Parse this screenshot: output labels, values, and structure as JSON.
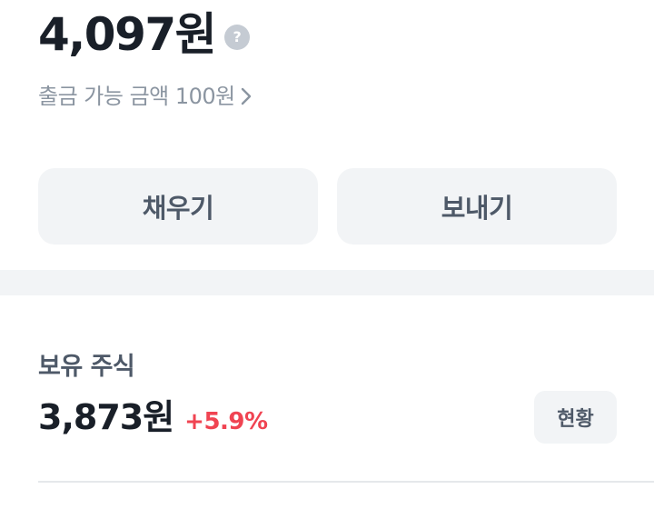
{
  "balance": {
    "amount": "4,097원",
    "help_icon": "question-circle-icon",
    "withdrawable_text": "출금 가능 금액 100원",
    "chevron_icon": "chevron-right-icon"
  },
  "actions": {
    "fill_label": "채우기",
    "send_label": "보내기"
  },
  "holdings": {
    "title": "보유 주식",
    "amount": "3,873원",
    "change": "+5.9%",
    "status_button": "현황"
  },
  "colors": {
    "text_primary": "#191f28",
    "text_secondary": "#8b95a1",
    "button_bg": "#f2f4f6",
    "positive_change": "#f04452"
  }
}
